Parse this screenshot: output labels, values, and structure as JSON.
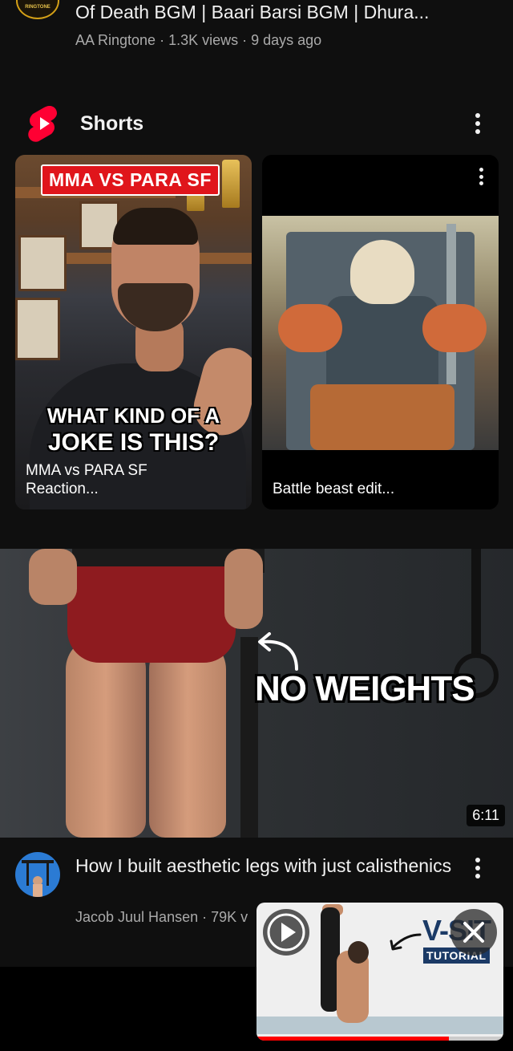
{
  "previous_video": {
    "channel_badge": "RINGTONE",
    "title": "Of Death BGM | Baari Barsi BGM | Dhura...",
    "meta": "AA Ringtone · 1.3K views · 9 days ago"
  },
  "shorts": {
    "section_label": "Shorts",
    "items": [
      {
        "banner": "MMA VS PARA SF",
        "overlay_line_1": "WHAT KIND OF A",
        "overlay_line_2": "JOKE IS THIS?",
        "caption_line_1": "MMA vs PARA SF",
        "caption_line_2": "Reaction..."
      },
      {
        "caption_line_1": "Battle beast edit..."
      }
    ]
  },
  "video": {
    "thumbnail_text": "NO WEIGHTS",
    "duration": "6:11",
    "title": "How I built aesthetic legs with just calisthenics",
    "meta": "Jacob Juul Hansen · 79K v"
  },
  "mini_player": {
    "overlay_title": "V-SIT",
    "overlay_subtitle": "TUTORIAL",
    "progress": 0.78,
    "icons": {
      "play": "play-icon",
      "close": "close-icon"
    }
  },
  "colors": {
    "background": "#0f0f0f",
    "shorts_red": "#ff0033",
    "progress_red": "#ff0000",
    "meta_gray": "#aaaaaa"
  }
}
